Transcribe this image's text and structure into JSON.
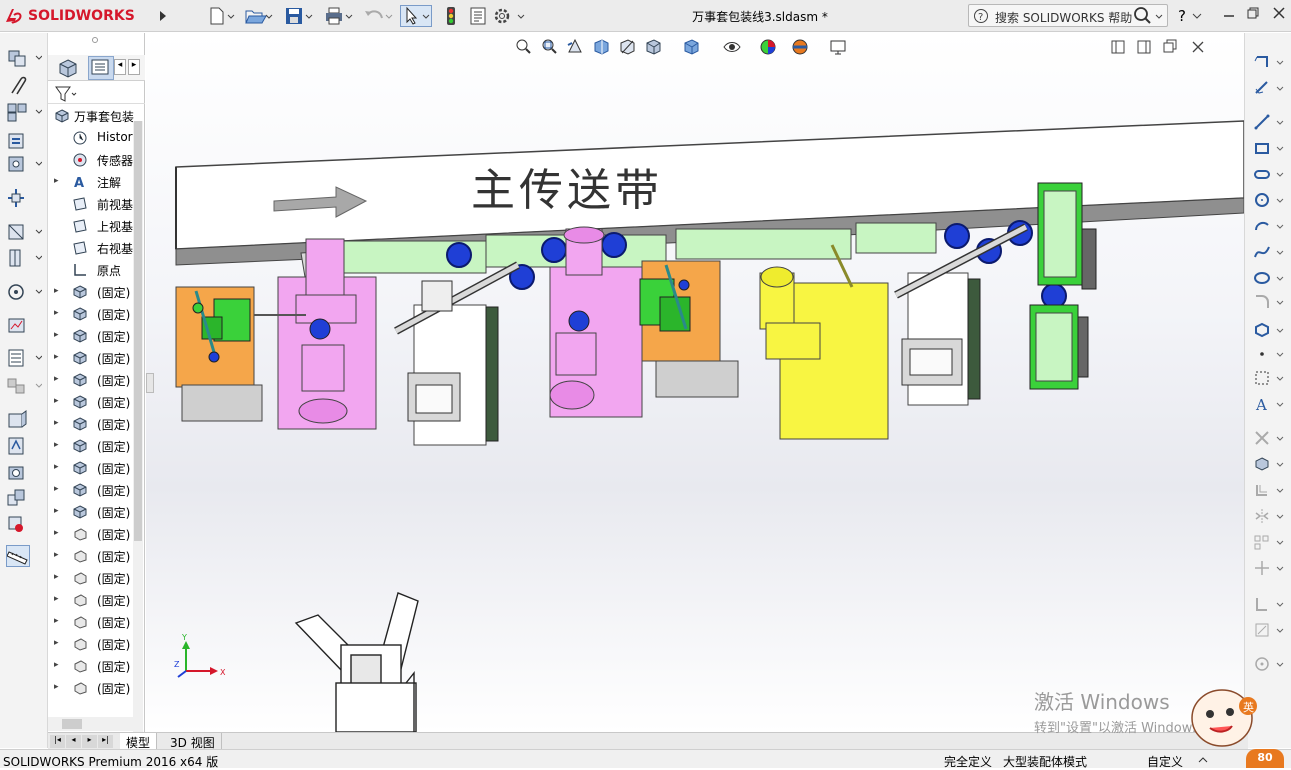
{
  "app": {
    "logo_text": "SOLIDWORKS",
    "doc_title": "万事套包装线3.sldasm *",
    "search_placeholder": "搜索 SOLIDWORKS 帮助",
    "help_label": "?"
  },
  "quick_toolbar": {
    "icons": [
      "new-document-icon",
      "open-folder-icon",
      "save-icon",
      "print-icon",
      "undo-icon",
      "select-cursor-icon",
      "rebuild-traffic-light-icon",
      "file-properties-icon",
      "options-gear-icon"
    ]
  },
  "view_toolbar": {
    "icons": [
      "zoom-to-fit-icon",
      "zoom-to-area-icon",
      "previous-view-icon",
      "section-view-icon",
      "dynamic-annotation-icon",
      "view-orientation-icon",
      "display-style-icon",
      "hide-show-items-icon",
      "edit-appearance-icon",
      "apply-scene-icon",
      "view-settings-icon"
    ]
  },
  "feature_tree": {
    "root": "万事套包装",
    "items": [
      {
        "label": "History",
        "icon": "history-icon",
        "expandable": false
      },
      {
        "label": "传感器",
        "icon": "sensors-icon",
        "expandable": false
      },
      {
        "label": "注解",
        "icon": "annotations-icon",
        "expandable": true
      },
      {
        "label": "前视基",
        "icon": "plane-icon",
        "expandable": false
      },
      {
        "label": "上视基",
        "icon": "plane-icon",
        "expandable": false
      },
      {
        "label": "右视基",
        "icon": "plane-icon",
        "expandable": false
      },
      {
        "label": "原点",
        "icon": "origin-icon",
        "expandable": false
      },
      {
        "label": "(固定)",
        "icon": "assembly-component-icon",
        "expandable": true
      },
      {
        "label": "(固定)",
        "icon": "assembly-component-icon",
        "expandable": true
      },
      {
        "label": "(固定)",
        "icon": "assembly-component-icon",
        "expandable": true
      },
      {
        "label": "(固定)",
        "icon": "assembly-component-icon",
        "expandable": true
      },
      {
        "label": "(固定)",
        "icon": "assembly-component-icon",
        "expandable": true
      },
      {
        "label": "(固定)",
        "icon": "assembly-component-icon",
        "expandable": true
      },
      {
        "label": "(固定)",
        "icon": "assembly-component-icon",
        "expandable": true
      },
      {
        "label": "(固定)",
        "icon": "assembly-component-icon",
        "expandable": true
      },
      {
        "label": "(固定)",
        "icon": "assembly-component-icon",
        "expandable": true
      },
      {
        "label": "(固定)",
        "icon": "assembly-component-icon",
        "expandable": true
      },
      {
        "label": "(固定)",
        "icon": "assembly-component-icon",
        "expandable": true
      },
      {
        "label": "(固定)",
        "icon": "part-icon",
        "expandable": true
      },
      {
        "label": "(固定)",
        "icon": "part-icon",
        "expandable": true
      },
      {
        "label": "(固定)",
        "icon": "part-icon",
        "expandable": true
      },
      {
        "label": "(固定)",
        "icon": "part-icon",
        "expandable": true
      },
      {
        "label": "(固定)",
        "icon": "part-icon",
        "expandable": true
      },
      {
        "label": "(固定)",
        "icon": "part-icon",
        "expandable": true
      },
      {
        "label": "(固定)",
        "icon": "part-icon",
        "expandable": true
      },
      {
        "label": "(固定)",
        "icon": "part-icon",
        "expandable": true
      }
    ]
  },
  "bottom_tabs": [
    {
      "label": "模型",
      "active": true
    },
    {
      "label": "3D 视图",
      "active": false
    }
  ],
  "viewport": {
    "conveyor_label": "主传送带",
    "triad_labels": {
      "x": "X",
      "y": "Y",
      "z": "Z"
    }
  },
  "watermark": {
    "line1": "激活 Windows",
    "line2": "转到\"设置\"以激活 Windows"
  },
  "statusbar": {
    "left": "SOLIDWORKS Premium 2016 x64 版",
    "fully_defined": "完全定义",
    "large_assembly": "大型装配体模式",
    "units": "自定义",
    "badge": "80"
  },
  "colors": {
    "accent_red": "#d5172b",
    "orange": "#f5a64a",
    "pink": "#f2a6f0",
    "yellow": "#f8f542",
    "light_green": "#c8f5c2",
    "green": "#3ad13a",
    "blue": "#1f3fd6"
  }
}
